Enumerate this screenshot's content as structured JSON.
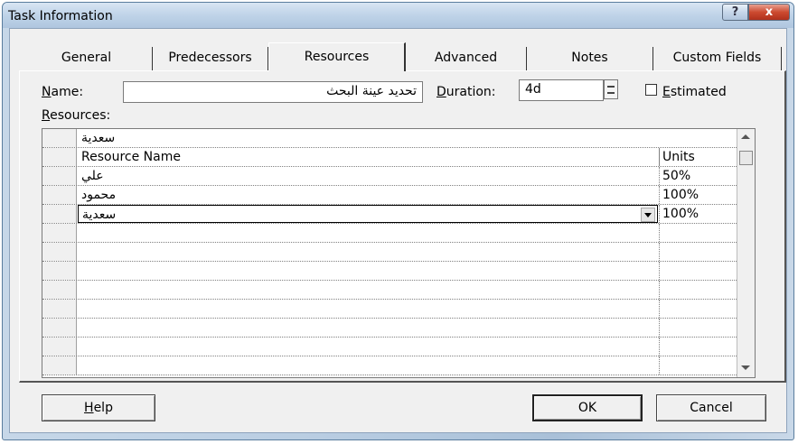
{
  "window": {
    "title": "Task Information",
    "help_glyph": "?",
    "close_glyph": "x"
  },
  "tabs": [
    {
      "label": "General",
      "active": false
    },
    {
      "label": "Predecessors",
      "active": false
    },
    {
      "label": "Resources",
      "active": true
    },
    {
      "label": "Advanced",
      "active": false
    },
    {
      "label": "Notes",
      "active": false
    },
    {
      "label": "Custom Fields",
      "active": false
    }
  ],
  "form": {
    "name_label": "Name:",
    "name_value": "تحديد عينة البحث",
    "duration_label": "Duration:",
    "duration_value": "4d",
    "estimated_label": "Estimated",
    "estimated_checked": false,
    "resources_label": "Resources:"
  },
  "grid": {
    "edit_value": "سعدية",
    "col_name": "Resource Name",
    "col_units": "Units",
    "rows": [
      {
        "name": "علي",
        "units": "50%"
      },
      {
        "name": "محمود",
        "units": "100%"
      },
      {
        "name": "سعدية",
        "units": "100%"
      }
    ],
    "empty_rows": 8
  },
  "buttons": {
    "help": "Help",
    "ok": "OK",
    "cancel": "Cancel"
  }
}
